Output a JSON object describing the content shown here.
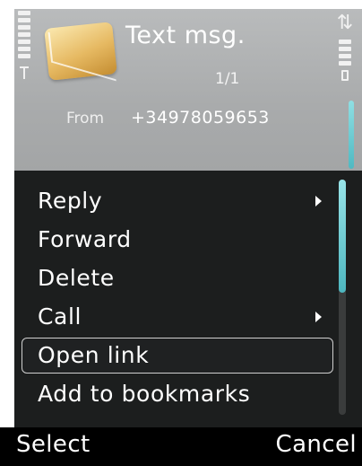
{
  "header": {
    "title": "Text msg.",
    "page_counter": "1/1",
    "from_label": "From",
    "from_number": "+34978059653"
  },
  "icons": {
    "message": "envelope-icon",
    "signal": "signal-strength-icon",
    "battery": "battery-icon",
    "connectivity": "usb-icon"
  },
  "menu": {
    "items": [
      {
        "label": "Reply",
        "submenu": true
      },
      {
        "label": "Forward",
        "submenu": false
      },
      {
        "label": "Delete",
        "submenu": false
      },
      {
        "label": "Call",
        "submenu": true
      },
      {
        "label": "Open link",
        "submenu": false,
        "selected": true
      },
      {
        "label": "Add to bookmarks",
        "submenu": false
      }
    ]
  },
  "softkeys": {
    "left": "Select",
    "right": "Cancel"
  },
  "colors": {
    "menu_background": "#1c1e1e",
    "scrollbar_accent": "#4db6bf",
    "header_background": "#a9abac"
  }
}
